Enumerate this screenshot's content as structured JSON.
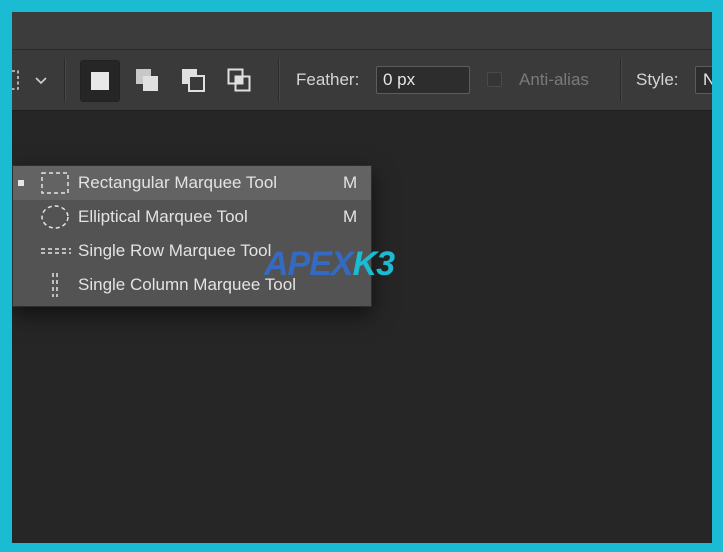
{
  "options_bar": {
    "selection_modes": [
      {
        "icon": "new-selection-icon",
        "active": true
      },
      {
        "icon": "add-to-selection-icon",
        "active": false
      },
      {
        "icon": "subtract-from-selection-icon",
        "active": false
      },
      {
        "icon": "intersect-selection-icon",
        "active": false
      }
    ],
    "feather_label": "Feather:",
    "feather_value": "0 px",
    "anti_alias_label": "Anti-alias",
    "anti_alias_checked": false,
    "style_label": "Style:",
    "style_value": "N"
  },
  "flyout": {
    "items": [
      {
        "icon": "rectangular-marquee-icon",
        "label": "Rectangular Marquee Tool",
        "shortcut": "M",
        "selected": true
      },
      {
        "icon": "elliptical-marquee-icon",
        "label": "Elliptical Marquee Tool",
        "shortcut": "M",
        "selected": false
      },
      {
        "icon": "single-row-marquee-icon",
        "label": "Single Row Marquee Tool",
        "shortcut": "",
        "selected": false
      },
      {
        "icon": "single-column-marquee-icon",
        "label": "Single Column Marquee Tool",
        "shortcut": "",
        "selected": false
      }
    ]
  },
  "watermark": {
    "part1": "APEX",
    "part2": "K3"
  },
  "colors": {
    "frame_border": "#1bbcd3",
    "options_bar_bg": "#3a3a3a",
    "canvas_bg": "#262626",
    "flyout_bg": "#535353",
    "flyout_selected_bg": "#636363",
    "watermark_blue": "#2f6fd6",
    "watermark_cyan": "#1bbcd3"
  }
}
